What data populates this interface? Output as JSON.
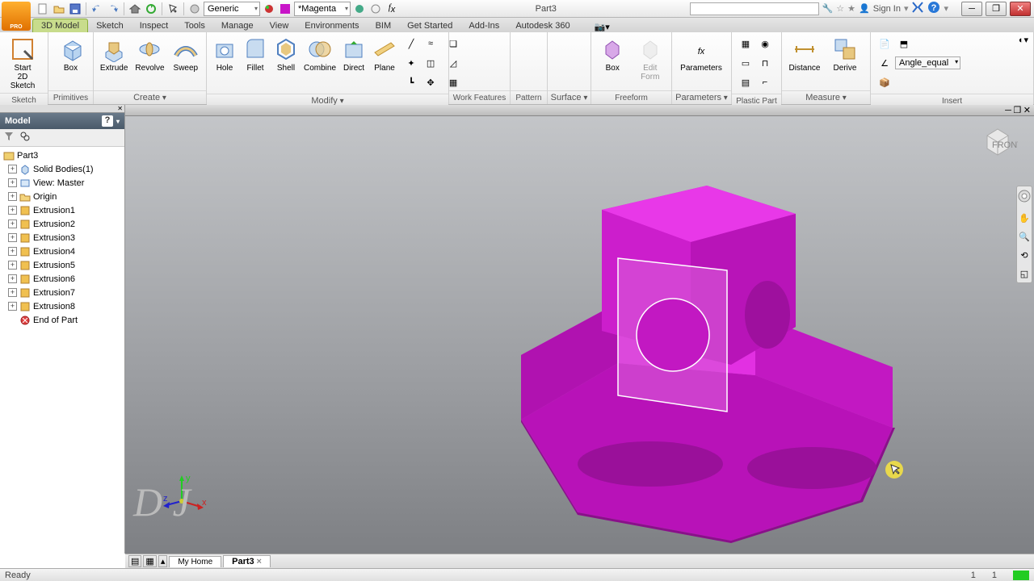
{
  "title": {
    "document": "Part3"
  },
  "qat": {
    "style_combo": "Generic",
    "color_combo": "*Magenta"
  },
  "signin": {
    "label": "Sign In"
  },
  "ribbon_tabs": [
    "3D Model",
    "Sketch",
    "Inspect",
    "Tools",
    "Manage",
    "View",
    "Environments",
    "BIM",
    "Get Started",
    "Add-Ins",
    "Autodesk 360"
  ],
  "active_tab_index": 0,
  "panels": {
    "sketch": {
      "title": "Sketch",
      "start": "Start\n2D Sketch"
    },
    "primitives": {
      "title": "Primitives",
      "box": "Box"
    },
    "create": {
      "title": "Create",
      "extrude": "Extrude",
      "revolve": "Revolve",
      "sweep": "Sweep"
    },
    "modify": {
      "title": "Modify",
      "hole": "Hole",
      "fillet": "Fillet",
      "shell": "Shell",
      "combine": "Combine",
      "direct": "Direct",
      "plane": "Plane"
    },
    "workfeat": {
      "title": "Work Features"
    },
    "pattern": {
      "title": "Pattern"
    },
    "surface": {
      "title": "Surface"
    },
    "freeform": {
      "title": "Freeform",
      "box": "Box",
      "edit": "Edit\nForm"
    },
    "parameters": {
      "title": "Parameters",
      "param": "Parameters"
    },
    "plastic": {
      "title": "Plastic Part"
    },
    "measure": {
      "title": "Measure",
      "distance": "Distance",
      "derive": "Derive"
    },
    "insert": {
      "title": "Insert",
      "angle": "Angle_equal"
    }
  },
  "browser": {
    "header": "Model",
    "root": "Part3",
    "items": [
      {
        "label": "Solid Bodies(1)",
        "expandable": true,
        "icon": "solid"
      },
      {
        "label": "View: Master",
        "expandable": true,
        "icon": "view"
      },
      {
        "label": "Origin",
        "expandable": true,
        "icon": "folder"
      },
      {
        "label": "Extrusion1",
        "expandable": true,
        "icon": "feature"
      },
      {
        "label": "Extrusion2",
        "expandable": true,
        "icon": "feature"
      },
      {
        "label": "Extrusion3",
        "expandable": true,
        "icon": "feature"
      },
      {
        "label": "Extrusion4",
        "expandable": true,
        "icon": "feature"
      },
      {
        "label": "Extrusion5",
        "expandable": true,
        "icon": "feature"
      },
      {
        "label": "Extrusion6",
        "expandable": true,
        "icon": "feature"
      },
      {
        "label": "Extrusion7",
        "expandable": true,
        "icon": "feature"
      },
      {
        "label": "Extrusion8",
        "expandable": true,
        "icon": "feature"
      },
      {
        "label": "End of Part",
        "expandable": false,
        "icon": "end"
      }
    ]
  },
  "doc_tabs": {
    "home": "My Home",
    "part": "Part3"
  },
  "status": {
    "text": "Ready",
    "n1": "1",
    "n2": "1"
  },
  "watermark": "D J"
}
